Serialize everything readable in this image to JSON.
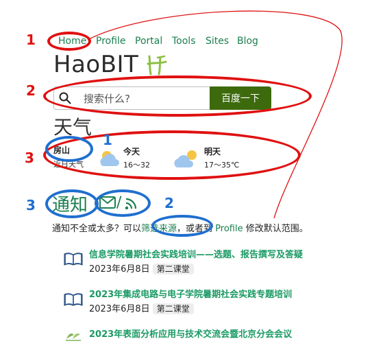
{
  "nav": {
    "items": [
      "Home",
      "Profile",
      "Portal",
      "Tools",
      "Sites",
      "Blog"
    ]
  },
  "site_title": "HaoBIT",
  "search": {
    "placeholder": "搜索什么?",
    "button_label": "百度一下"
  },
  "weather": {
    "heading": "天气",
    "location": "房山",
    "location_sub": "近日天气",
    "days": [
      {
        "label": "今天",
        "temp": "16～32",
        "icon": "partly-cloudy-icon"
      },
      {
        "label": "明天",
        "temp": "17～35℃",
        "icon": "partly-cloudy-icon"
      }
    ]
  },
  "notices": {
    "heading": "通知",
    "icons": [
      "mail-icon",
      "rss-icon"
    ],
    "icon_glyph": "✉/ ",
    "hint_prefix": "通知不全或太多？可以",
    "hint_link1": "筛选来源",
    "hint_middle": "，或者到",
    "hint_link2": "Profile",
    "hint_suffix": "修改默认范围。",
    "items": [
      {
        "title": "信息学院暑期社会实践培训——选题、报告撰写及答疑",
        "date": "2023年6月8日",
        "tag": "第二课堂",
        "icon": "book-icon"
      },
      {
        "title": "2023年集成电路与电子学院暑期社会实践专题培训",
        "date": "2023年6月8日",
        "tag": "第二课堂",
        "icon": "book-icon"
      },
      {
        "title": "2023年表面分析应用与技术交流会暨北京分会会议",
        "date": "",
        "tag": "",
        "icon": "leaf-icon"
      }
    ]
  },
  "annotations": {
    "red": [
      "1",
      "2",
      "3"
    ],
    "blue": [
      "1",
      "2",
      "3"
    ],
    "colors": {
      "red": "#e01010",
      "blue": "#1f6fcf"
    }
  },
  "colors": {
    "link": "#1a7f4e",
    "search_button": "#3d6a0d",
    "item_title": "#1a9a64"
  }
}
